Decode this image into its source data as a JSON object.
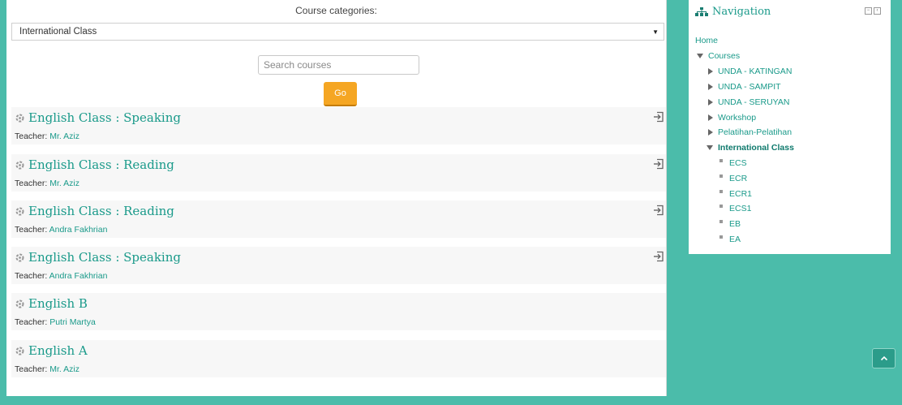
{
  "filter": {
    "label": "Course categories:",
    "selected": "International Class",
    "search_placeholder": "Search courses",
    "go_label": "Go"
  },
  "courses": [
    {
      "title": "English Class : Speaking",
      "teacher_label": "Teacher:",
      "teacher": "Mr. Aziz",
      "enrol_icon": true
    },
    {
      "title": "English Class : Reading",
      "teacher_label": "Teacher:",
      "teacher": "Mr. Aziz",
      "enrol_icon": true
    },
    {
      "title": "English Class : Reading",
      "teacher_label": "Teacher:",
      "teacher": "Andra Fakhrian",
      "enrol_icon": true
    },
    {
      "title": "English Class : Speaking",
      "teacher_label": "Teacher:",
      "teacher": "Andra Fakhrian",
      "enrol_icon": true
    },
    {
      "title": "English B",
      "teacher_label": "Teacher:",
      "teacher": "Putri Martya",
      "enrol_icon": false
    },
    {
      "title": "English A",
      "teacher_label": "Teacher:",
      "teacher": "Mr. Aziz",
      "enrol_icon": false
    }
  ],
  "navigation": {
    "title": "Navigation",
    "home": "Home",
    "courses": "Courses",
    "categories": [
      "UNDA - KATINGAN",
      "UNDA - SAMPIT",
      "UNDA - SERUYAN",
      "Workshop",
      "Pelatihan-Pelatihan"
    ],
    "active_category": "International Class",
    "subcourses": [
      "ECS",
      "ECR",
      "ECR1",
      "ECS1",
      "EB",
      "EA"
    ]
  },
  "colors": {
    "background": "#4bbcaa",
    "accent": "#1a9a8a",
    "go_button": "#f5a623"
  },
  "icons": {
    "course": "course-category-icon",
    "enrol": "enrol-icon",
    "nav": "sitemap-icon",
    "back_to_top": "chevron-up-icon"
  }
}
